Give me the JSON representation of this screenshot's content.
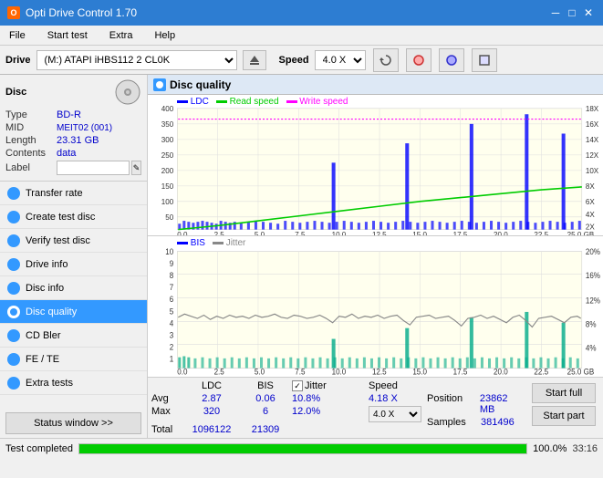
{
  "titleBar": {
    "title": "Opti Drive Control 1.70",
    "minBtn": "─",
    "maxBtn": "□",
    "closeBtn": "✕"
  },
  "menuBar": {
    "items": [
      "File",
      "Start test",
      "Extra",
      "Help"
    ]
  },
  "driveBar": {
    "label": "Drive",
    "driveValue": "(M:)  ATAPI iHBS112  2 CL0K",
    "speedLabel": "Speed",
    "speedValue": "4.0 X"
  },
  "sidebar": {
    "discTitle": "Disc",
    "discInfo": {
      "type": {
        "key": "Type",
        "val": "BD-R"
      },
      "mid": {
        "key": "MID",
        "val": "MEIT02 (001)"
      },
      "length": {
        "key": "Length",
        "val": "23.31 GB"
      },
      "contents": {
        "key": "Contents",
        "val": "data"
      },
      "label": {
        "key": "Label",
        "val": ""
      }
    },
    "navItems": [
      {
        "id": "transfer-rate",
        "label": "Transfer rate",
        "active": false
      },
      {
        "id": "create-test-disc",
        "label": "Create test disc",
        "active": false
      },
      {
        "id": "verify-test-disc",
        "label": "Verify test disc",
        "active": false
      },
      {
        "id": "drive-info",
        "label": "Drive info",
        "active": false
      },
      {
        "id": "disc-info",
        "label": "Disc info",
        "active": false
      },
      {
        "id": "disc-quality",
        "label": "Disc quality",
        "active": true
      },
      {
        "id": "cd-bler",
        "label": "CD Bler",
        "active": false
      },
      {
        "id": "fe-te",
        "label": "FE / TE",
        "active": false
      },
      {
        "id": "extra-tests",
        "label": "Extra tests",
        "active": false
      }
    ],
    "statusBtn": "Status window >>"
  },
  "discQuality": {
    "title": "Disc quality",
    "chart1": {
      "legend": {
        "ldc": "LDC",
        "read": "Read speed",
        "write": "Write speed"
      },
      "yMax": 400,
      "yLabelsLeft": [
        400,
        350,
        300,
        250,
        200,
        150,
        100,
        50
      ],
      "yLabelsRight": [
        "18X",
        "16X",
        "14X",
        "12X",
        "10X",
        "8X",
        "6X",
        "4X",
        "2X"
      ],
      "xLabels": [
        "0.0",
        "2.5",
        "5.0",
        "7.5",
        "10.0",
        "12.5",
        "15.0",
        "17.5",
        "20.0",
        "22.5",
        "25.0 GB"
      ]
    },
    "chart2": {
      "legend": {
        "bis": "BIS",
        "jitter": "Jitter"
      },
      "yMax": 10,
      "yLabelsLeft": [
        10,
        9,
        8,
        7,
        6,
        5,
        4,
        3,
        2,
        1
      ],
      "yLabelsRight": [
        "20%",
        "16%",
        "12%",
        "8%",
        "4%"
      ],
      "xLabels": [
        "0.0",
        "2.5",
        "5.0",
        "7.5",
        "10.0",
        "12.5",
        "15.0",
        "17.5",
        "20.0",
        "22.5",
        "25.0 GB"
      ]
    },
    "stats": {
      "headers": [
        "",
        "LDC",
        "BIS",
        "",
        "Jitter",
        "Speed"
      ],
      "avg": {
        "label": "Avg",
        "ldc": "2.87",
        "bis": "0.06",
        "jitter": "10.8%",
        "speed": "4.18 X",
        "speedTarget": "4.0 X"
      },
      "max": {
        "label": "Max",
        "ldc": "320",
        "bis": "6",
        "jitter": "12.0%",
        "position": "23862 MB"
      },
      "total": {
        "label": "Total",
        "ldc": "1096122",
        "bis": "21309",
        "samples": "381496"
      }
    },
    "jitterChecked": true,
    "jitterLabel": "Jitter",
    "positionLabel": "Position",
    "samplesLabel": "Samples",
    "buttons": {
      "startFull": "Start full",
      "startPart": "Start part"
    }
  },
  "bottomBar": {
    "status": "Test completed",
    "progress": 100,
    "time": "33:16"
  }
}
